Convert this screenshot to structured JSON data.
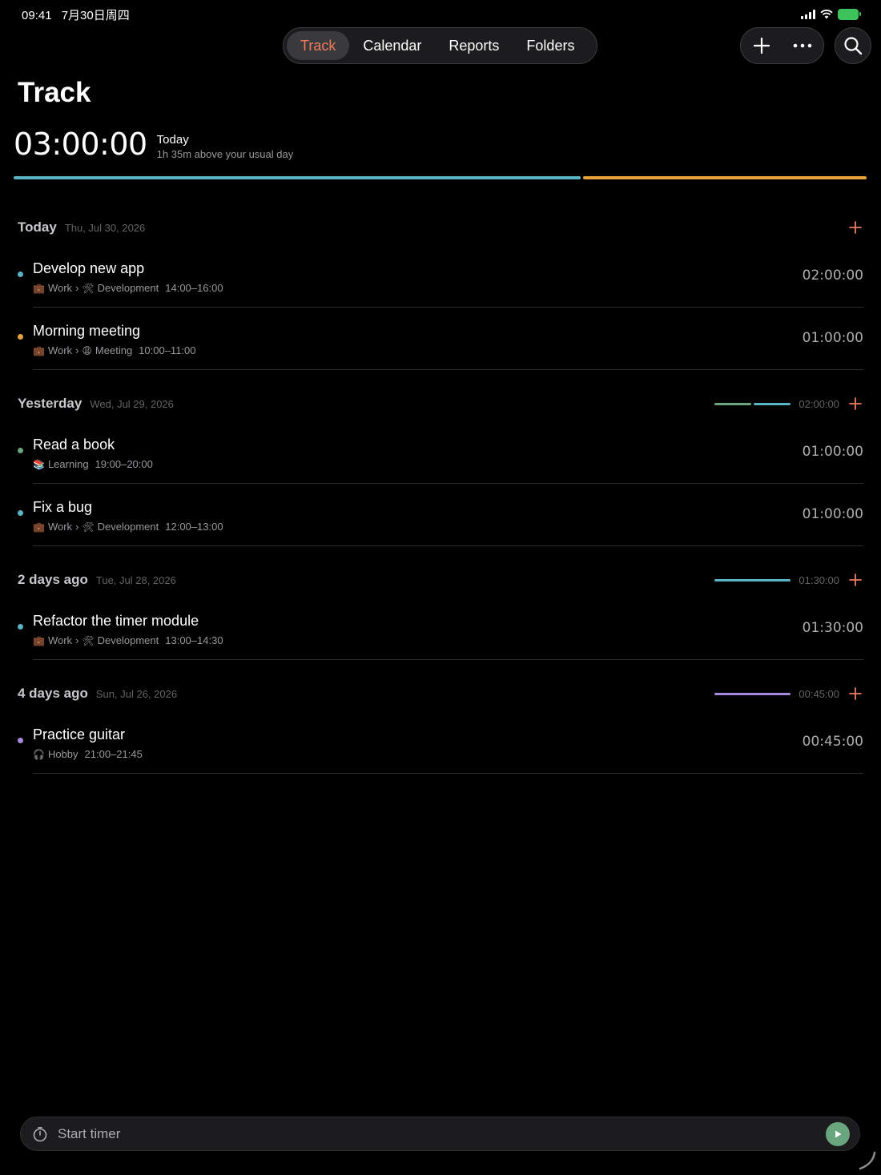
{
  "status": {
    "time": "09:41",
    "date": "7月30日周四"
  },
  "nav": {
    "tabs": [
      {
        "label": "Track",
        "active": true
      },
      {
        "label": "Calendar",
        "active": false
      },
      {
        "label": "Reports",
        "active": false
      },
      {
        "label": "Folders",
        "active": false
      }
    ]
  },
  "header": {
    "title": "Track",
    "total": "03:00:00",
    "total_label": "Today",
    "total_sub": "1h 35m above your usual day"
  },
  "colors": {
    "accent": "#ef7b5f",
    "teal": "#5ab4c5",
    "orange": "#e8a23c",
    "green": "#6aa67d",
    "purple": "#a78bdb"
  },
  "sections": [
    {
      "title": "Today",
      "date": "Thu, Jul 30, 2026",
      "total": "",
      "entries": [
        {
          "title": "Develop new app",
          "color": "#5ab4c5",
          "project": "Work",
          "project_icon": "briefcase-icon",
          "sub": "Development",
          "sub_icon": "tools-icon",
          "time_range": "14:00–16:00",
          "duration": "02:00:00"
        },
        {
          "title": "Morning meeting",
          "color": "#e8a23c",
          "project": "Work",
          "project_icon": "briefcase-icon",
          "sub": "Meeting",
          "sub_icon": "face-icon",
          "time_range": "10:00–11:00",
          "duration": "01:00:00"
        }
      ]
    },
    {
      "title": "Yesterday",
      "date": "Wed, Jul 29, 2026",
      "total": "02:00:00",
      "entries": [
        {
          "title": "Read a book",
          "color": "#6aa67d",
          "project": "Learning",
          "project_icon": "books-icon",
          "sub": "",
          "sub_icon": "",
          "time_range": "19:00–20:00",
          "duration": "01:00:00"
        },
        {
          "title": "Fix a bug",
          "color": "#5ab4c5",
          "project": "Work",
          "project_icon": "briefcase-icon",
          "sub": "Development",
          "sub_icon": "tools-icon",
          "time_range": "12:00–13:00",
          "duration": "01:00:00"
        }
      ]
    },
    {
      "title": "2 days ago",
      "date": "Tue, Jul 28, 2026",
      "total": "01:30:00",
      "entries": [
        {
          "title": "Refactor the timer module",
          "color": "#5ab4c5",
          "project": "Work",
          "project_icon": "briefcase-icon",
          "sub": "Development",
          "sub_icon": "tools-icon",
          "time_range": "13:00–14:30",
          "duration": "01:30:00"
        }
      ]
    },
    {
      "title": "4 days ago",
      "date": "Sun, Jul 26, 2026",
      "total": "00:45:00",
      "entries": [
        {
          "title": "Practice guitar",
          "color": "#a78bdb",
          "project": "Hobby",
          "project_icon": "headphones-icon",
          "sub": "",
          "sub_icon": "",
          "time_range": "21:00–21:45",
          "duration": "00:45:00"
        }
      ]
    }
  ],
  "timer": {
    "placeholder": "Start timer"
  }
}
